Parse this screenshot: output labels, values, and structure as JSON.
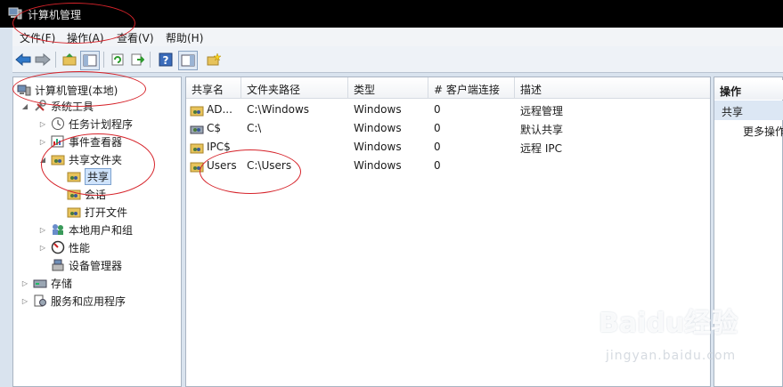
{
  "window": {
    "title": "计算机管理"
  },
  "menu": [
    "文件(F)",
    "操作(A)",
    "查看(V)",
    "帮助(H)"
  ],
  "tree": {
    "root": "计算机管理(本地)",
    "system_tools": "系统工具",
    "task_scheduler": "任务计划程序",
    "event_viewer": "事件查看器",
    "shared_folders": "共享文件夹",
    "shares": "共享",
    "sessions": "会话",
    "open_files": "打开文件",
    "local_users": "本地用户和组",
    "performance": "性能",
    "device_manager": "设备管理器",
    "storage": "存储",
    "services_apps": "服务和应用程序"
  },
  "table": {
    "headers": [
      "共享名",
      "文件夹路径",
      "类型",
      "# 客户端连接",
      "描述"
    ],
    "rows": [
      {
        "name": "AD...",
        "path": "C:\\Windows",
        "type": "Windows",
        "clients": "0",
        "desc": "远程管理"
      },
      {
        "name": "C$",
        "path": "C:\\",
        "type": "Windows",
        "clients": "0",
        "desc": "默认共享"
      },
      {
        "name": "IPC$",
        "path": "",
        "type": "Windows",
        "clients": "0",
        "desc": "远程 IPC"
      },
      {
        "name": "Users",
        "path": "C:\\Users",
        "type": "Windows",
        "clients": "0",
        "desc": ""
      }
    ]
  },
  "actions": {
    "header": "操作",
    "section": "共享",
    "more": "更多操作"
  },
  "watermark": {
    "brand": "Baidu经验",
    "url": "jingyan.baidu.com"
  }
}
